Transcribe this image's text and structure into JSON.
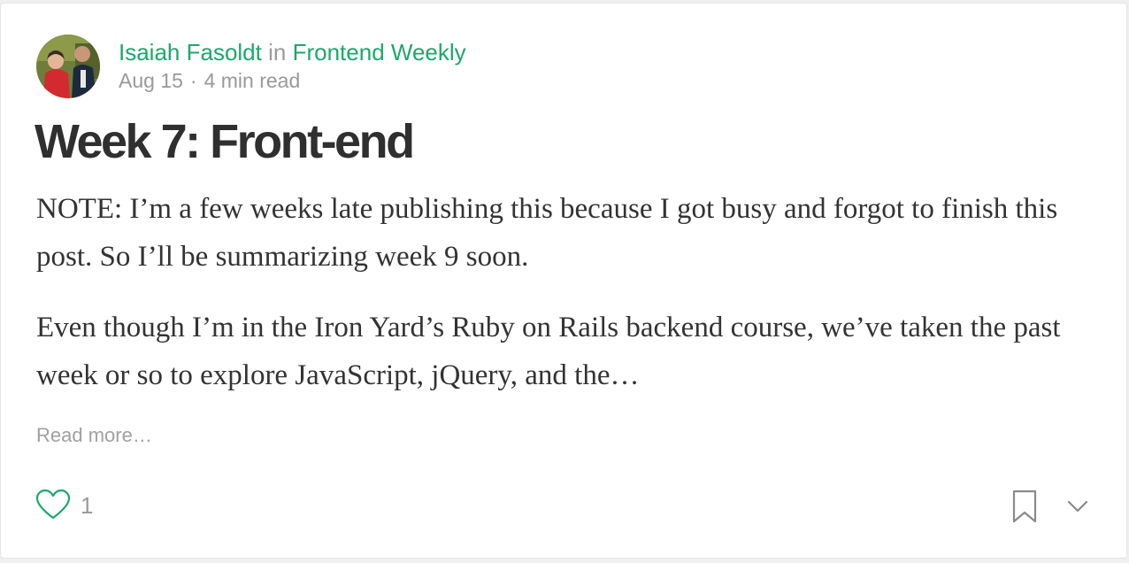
{
  "post": {
    "author": "Isaiah Fasoldt",
    "in_word": "in",
    "publication": "Frontend Weekly",
    "date": "Aug 15",
    "separator": "·",
    "read_time": "4 min read",
    "title": "Week 7: Front-end",
    "paragraph_1": "NOTE: I’m a few weeks late publishing this because I got busy and forgot to finish this post. So I’ll be summarizing week 9 soon.",
    "paragraph_2": "Even though I’m in the Iron Yard’s Ruby on Rails backend course, we’ve taken the past week or so to explore JavaScript, jQuery, and the…",
    "read_more": "Read more…"
  },
  "actions": {
    "clap_icon": "heart-icon",
    "clap_count": "1",
    "bookmark_icon": "bookmark-icon",
    "more_icon": "chevron-down-icon"
  },
  "colors": {
    "accent_green": "#1ea76b",
    "muted_text": "#9b9b9b",
    "title_text": "#2f2f2f",
    "body_text": "#333333"
  }
}
